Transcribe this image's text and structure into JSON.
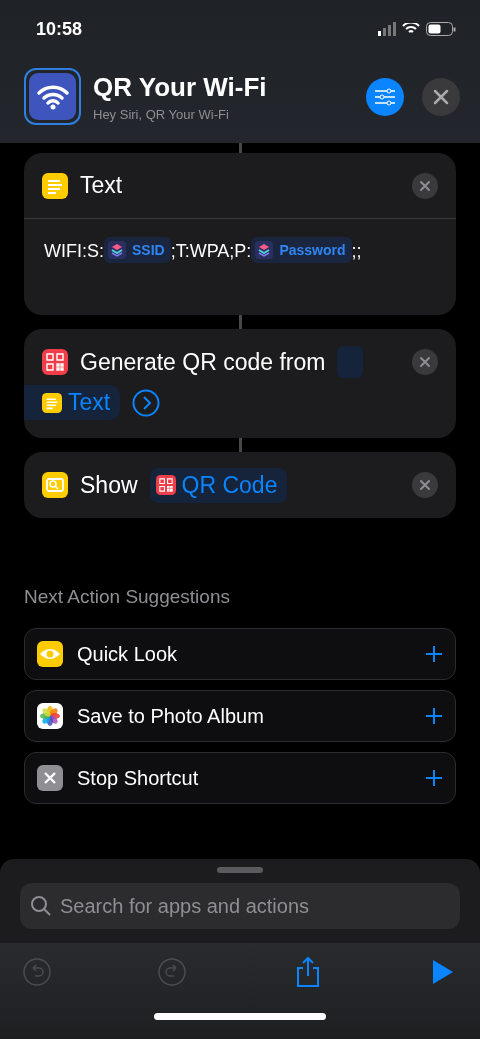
{
  "status_bar": {
    "time": "10:58"
  },
  "header": {
    "title": "QR Your Wi-Fi",
    "subtitle": "Hey Siri, QR Your Wi-Fi"
  },
  "actions": [
    {
      "kind": "text",
      "title": "Text",
      "body": [
        {
          "kind": "plain",
          "text": "WIFI:S:"
        },
        {
          "kind": "variable",
          "text": "SSID"
        },
        {
          "kind": "plain",
          "text": ";T:WPA;P:"
        },
        {
          "kind": "variable",
          "text": "Password"
        },
        {
          "kind": "plain",
          "text": ";;"
        }
      ]
    },
    {
      "kind": "qr",
      "title": "Generate QR code from",
      "input": {
        "kind": "text",
        "text": "Text"
      },
      "expandable": true
    },
    {
      "kind": "show",
      "title": "Show",
      "input": {
        "kind": "qr",
        "text": "QR Code"
      }
    }
  ],
  "suggestions": {
    "heading": "Next Action Suggestions",
    "items": [
      {
        "kind": "eye",
        "label": "Quick Look"
      },
      {
        "kind": "photos",
        "label": "Save to Photo Album"
      },
      {
        "kind": "stop",
        "label": "Stop Shortcut"
      }
    ]
  },
  "search": {
    "placeholder": "Search for apps and actions"
  },
  "toolbar": [
    {
      "kind": "undo",
      "disabled": true
    },
    {
      "kind": "redo",
      "disabled": true
    },
    {
      "kind": "share",
      "disabled": false
    },
    {
      "kind": "run",
      "disabled": false
    }
  ]
}
